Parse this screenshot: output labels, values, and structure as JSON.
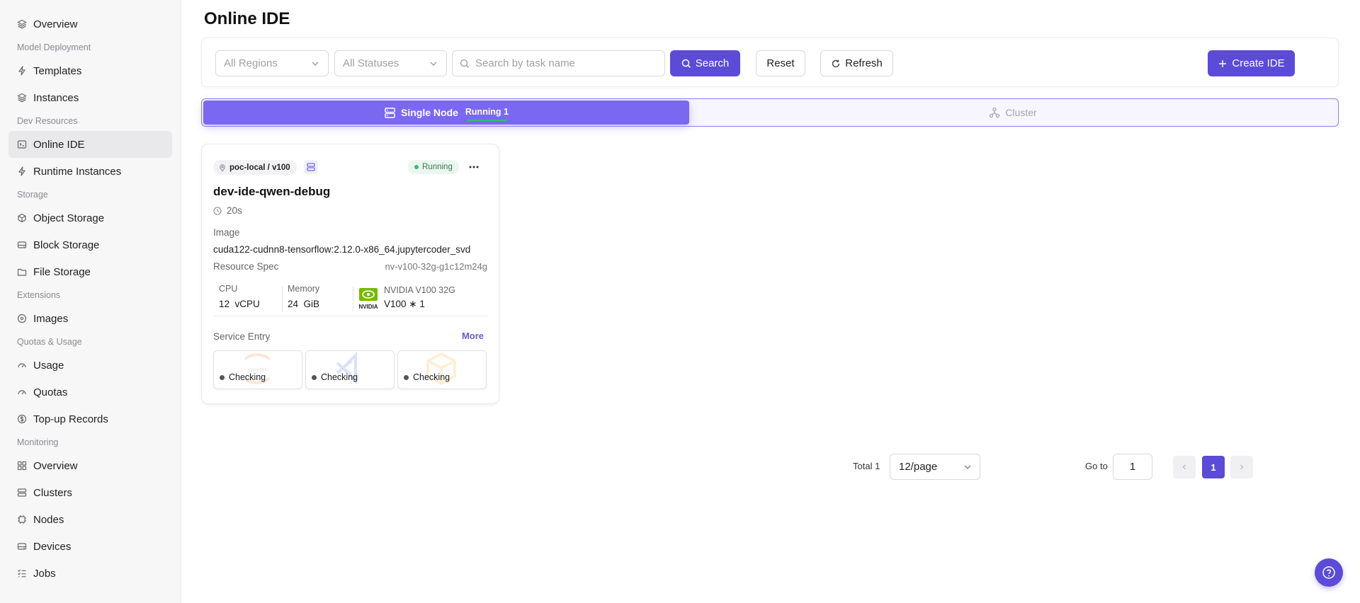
{
  "sidebar": {
    "items": [
      {
        "type": "item",
        "label": "Overview",
        "icon": "layers-icon",
        "name": "sidebar-item-overview"
      },
      {
        "type": "group",
        "label": "Model Deployment"
      },
      {
        "type": "item",
        "label": "Templates",
        "icon": "sparkle-icon",
        "name": "sidebar-item-templates"
      },
      {
        "type": "item",
        "label": "Instances",
        "icon": "layers-icon",
        "name": "sidebar-item-instances"
      },
      {
        "type": "group",
        "label": "Dev Resources"
      },
      {
        "type": "item",
        "label": "Online IDE",
        "icon": "terminal-icon",
        "name": "sidebar-item-online-ide",
        "active": true
      },
      {
        "type": "item",
        "label": "Runtime Instances",
        "icon": "sparkle-icon",
        "name": "sidebar-item-runtime-instances"
      },
      {
        "type": "group",
        "label": "Storage"
      },
      {
        "type": "item",
        "label": "Object Storage",
        "icon": "cube-icon",
        "name": "sidebar-item-object-storage"
      },
      {
        "type": "item",
        "label": "Block Storage",
        "icon": "drive-icon",
        "name": "sidebar-item-block-storage"
      },
      {
        "type": "item",
        "label": "File Storage",
        "icon": "folder-icon",
        "name": "sidebar-item-file-storage"
      },
      {
        "type": "group",
        "label": "Extensions"
      },
      {
        "type": "item",
        "label": "Images",
        "icon": "disc-icon",
        "name": "sidebar-item-images"
      },
      {
        "type": "group",
        "label": "Quotas & Usage"
      },
      {
        "type": "item",
        "label": "Usage",
        "icon": "gauge-icon",
        "name": "sidebar-item-usage"
      },
      {
        "type": "item",
        "label": "Quotas",
        "icon": "gauge-icon",
        "name": "sidebar-item-quotas"
      },
      {
        "type": "item",
        "label": "Top-up Records",
        "icon": "dollar-icon",
        "name": "sidebar-item-top-up-records"
      },
      {
        "type": "group",
        "label": "Monitoring"
      },
      {
        "type": "item",
        "label": "Overview",
        "icon": "grid-icon",
        "name": "sidebar-item-monitoring-overview"
      },
      {
        "type": "item",
        "label": "Clusters",
        "icon": "server-icon",
        "name": "sidebar-item-clusters"
      },
      {
        "type": "item",
        "label": "Nodes",
        "icon": "chip-icon",
        "name": "sidebar-item-nodes"
      },
      {
        "type": "item",
        "label": "Devices",
        "icon": "drive-icon",
        "name": "sidebar-item-devices"
      },
      {
        "type": "item",
        "label": "Jobs",
        "icon": "list-check-icon",
        "name": "sidebar-item-jobs"
      }
    ]
  },
  "page": {
    "title": "Online IDE"
  },
  "filters": {
    "region_placeholder": "All Regions",
    "status_placeholder": "All Statuses",
    "search_placeholder": "Search by task name",
    "search_label": "Search",
    "reset_label": "Reset",
    "refresh_label": "Refresh",
    "create_label": "Create IDE"
  },
  "tabs": {
    "single_label": "Single Node",
    "single_badge": "Running 1",
    "cluster_label": "Cluster"
  },
  "ide_card": {
    "location": "poc-local / v100",
    "status": "Running",
    "name": "dev-ide-qwen-debug",
    "duration": "20s",
    "image_label": "Image",
    "image_value": "cuda122-cudnn8-tensorflow:2.12.0-x86_64.jupytercoder_svd",
    "spec_label": "Resource Spec",
    "spec_value": "nv-v100-32g-g1c12m24g",
    "cpu_label": "CPU",
    "cpu_value": "12  vCPU",
    "memory_label": "Memory",
    "memory_value": "24  GiB",
    "gpu_model": "NVIDIA V100 32G",
    "gpu_count": "V100 ∗ 1",
    "gpu_brand": "NVIDIA",
    "service_label": "Service Entry",
    "more_label": "More",
    "services": [
      {
        "status": "Checking",
        "icon": "jupyter-icon",
        "name": "service-jupyter"
      },
      {
        "status": "Checking",
        "icon": "vscode-icon",
        "name": "service-vscode"
      },
      {
        "status": "Checking",
        "icon": "package-icon",
        "name": "service-package"
      }
    ]
  },
  "pagination": {
    "total_label": "Total 1",
    "page_size": "12/page",
    "current_page": "1",
    "goto_label": "Go to",
    "goto_value": "1"
  },
  "colors": {
    "accent": "#5b4bd6",
    "tab_active": "#7a68f0",
    "running_green": "#2fbf71"
  }
}
